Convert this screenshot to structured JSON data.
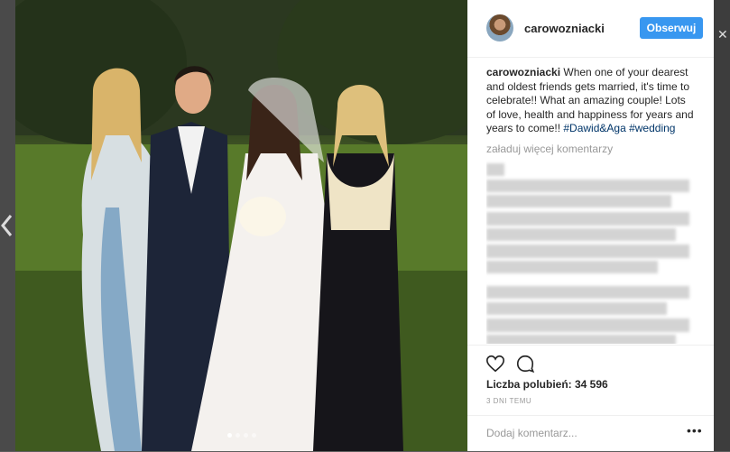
{
  "post": {
    "username": "carowozniacki",
    "follow_label": "Obserwuj",
    "caption_username": "carowozniacki",
    "caption_text": " When one of your dearest and oldest friends gets married, it's time to celebrate!! What an amazing couple! Lots of love, health and happiness for years and years to come!! ",
    "hashtags": [
      "#Dawid&Aga",
      "#wedding"
    ],
    "load_more": "załaduj więcej komentarzy",
    "likes_text": "Liczba polubień: 34 596",
    "time_ago": "3 DNI TEMU",
    "add_comment_placeholder": "Dodaj komentarz...",
    "options": "•••"
  },
  "carousel": {
    "count": 4,
    "active": 0
  },
  "colors": {
    "accent": "#3897f0",
    "hashtag": "#003569",
    "muted": "#999999"
  },
  "icons": [
    "heart-icon",
    "comment-icon",
    "chevron-left-icon",
    "more-options-icon"
  ]
}
